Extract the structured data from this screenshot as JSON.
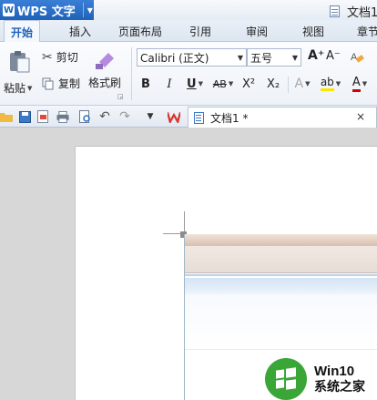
{
  "app": {
    "name": "WPS 文字",
    "logo_glyph": "W",
    "menu_caret": "▼"
  },
  "window": {
    "doc_title": "文档1"
  },
  "tabs": [
    {
      "label": "开始",
      "active": true
    },
    {
      "label": "插入",
      "active": false
    },
    {
      "label": "页面布局",
      "active": false
    },
    {
      "label": "引用",
      "active": false
    },
    {
      "label": "审阅",
      "active": false
    },
    {
      "label": "视图",
      "active": false
    },
    {
      "label": "章节",
      "active": false
    }
  ],
  "ribbon": {
    "paste_label": "粘贴",
    "cut_label": "剪切",
    "copy_label": "复制",
    "format_painter_label": "格式刷",
    "font_name": "Calibri (正文)",
    "font_size": "五号",
    "bold": "B",
    "italic": "I",
    "underline": "U",
    "strikethrough": "AB",
    "superscript": "X²",
    "subscript": "X₂",
    "grow_font": "A⁺",
    "shrink_font": "A⁻",
    "text_effect": "A",
    "highlight": "ab",
    "font_color": "A"
  },
  "quick_access": {
    "doc_tab_label": "文档1 *",
    "close_glyph": "×"
  },
  "watermark": {
    "line1": "Win10",
    "line2": "系统之家"
  },
  "colors": {
    "app_blue": "#1f62b8",
    "font_color_underline": "#d40000",
    "highlight_underline": "#ffe600",
    "watermark_green": "#3aa638"
  }
}
